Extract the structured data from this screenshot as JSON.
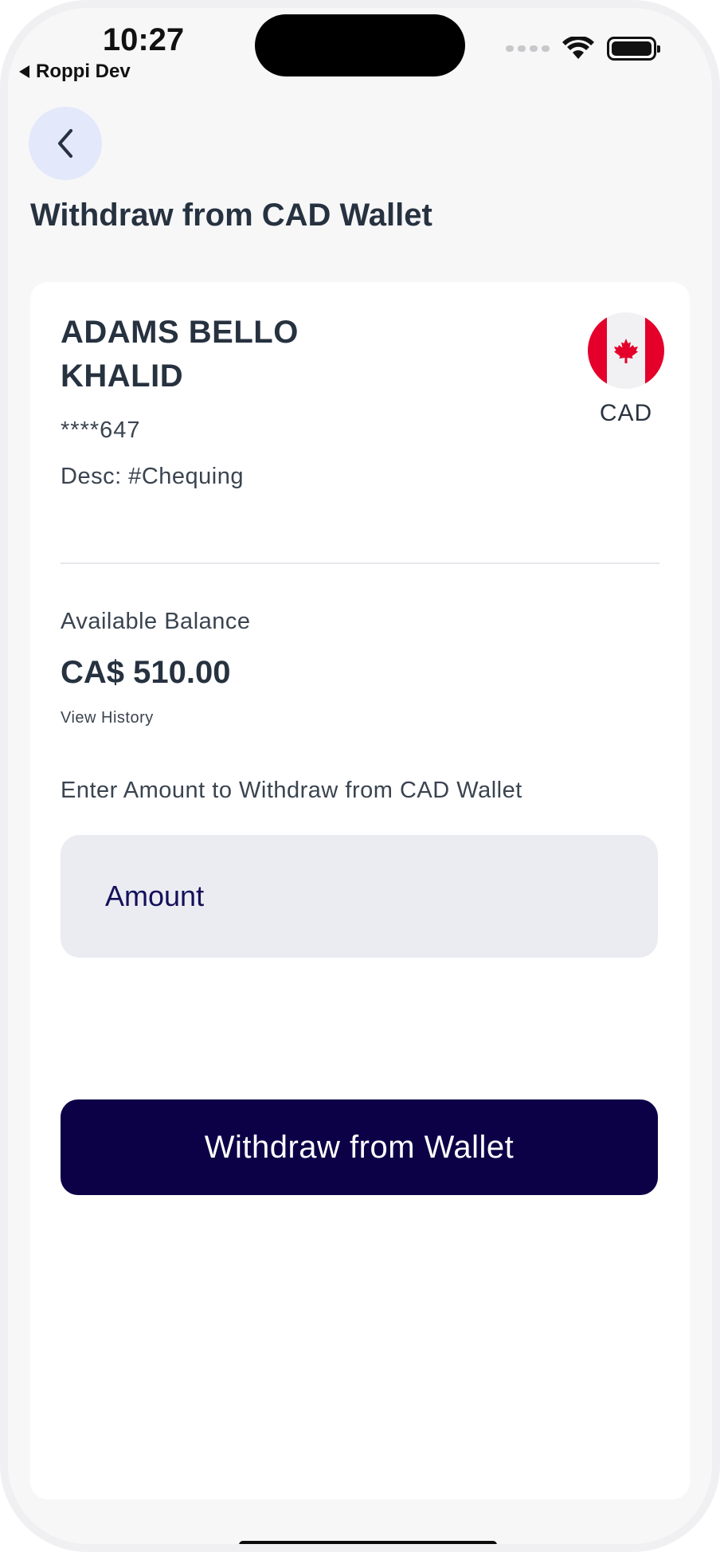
{
  "status_bar": {
    "time": "10:27",
    "back_app": "Roppi Dev"
  },
  "header": {
    "back_icon": "chevron-left-icon",
    "title": "Withdraw from CAD Wallet"
  },
  "account": {
    "name": "ADAMS BELLO KHALID",
    "number_masked": "****647",
    "description": "Desc: #Chequing",
    "currency_code": "CAD",
    "flag_icon": "canada-flag-icon"
  },
  "balance": {
    "label": "Available Balance",
    "value": "CA$ 510.00",
    "history_link": "View History"
  },
  "withdraw": {
    "prompt": "Enter Amount to Withdraw from CAD Wallet",
    "amount_placeholder": "Amount",
    "amount_value": "",
    "button_label": "Withdraw from Wallet"
  },
  "colors": {
    "primary": "#0c0047",
    "back_button_bg": "#e3e8fb",
    "input_bg": "#ebecf2",
    "flag_red": "#e4002b"
  }
}
